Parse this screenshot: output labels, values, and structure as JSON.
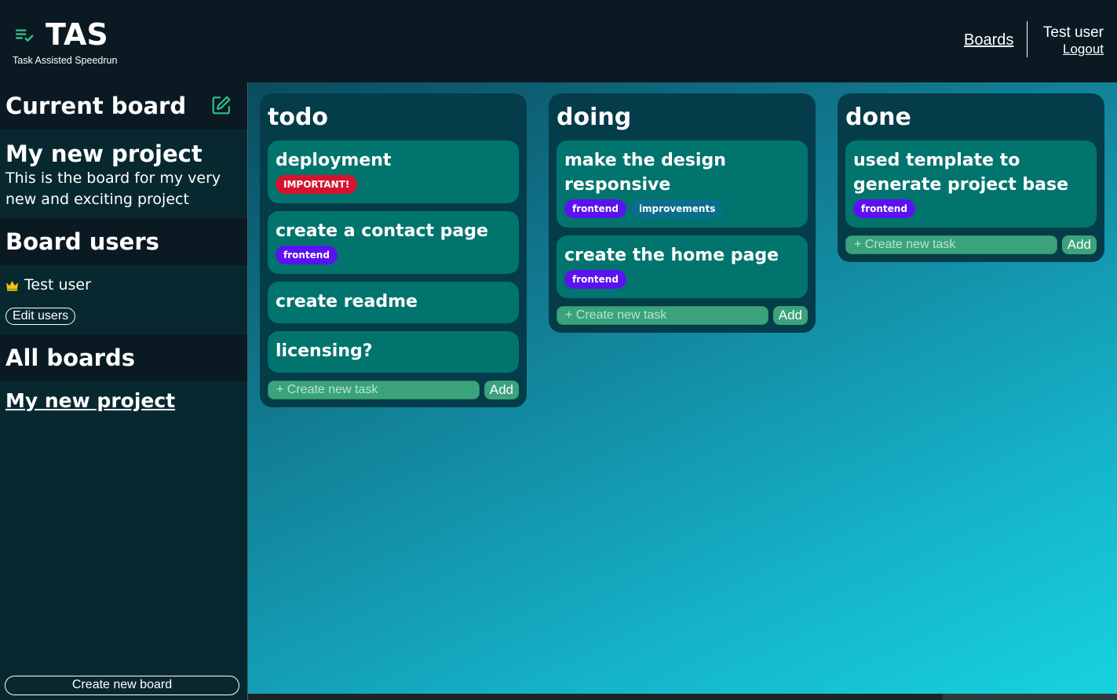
{
  "header": {
    "title": "TAS",
    "subtitle": "Task Assisted Speedrun",
    "nav_boards": "Boards",
    "user_name": "Test user",
    "logout": "Logout"
  },
  "sidebar": {
    "current_board_heading": "Current board",
    "board_name": "My new project",
    "board_description": "This is the board for my very new and exciting project",
    "board_users_heading": "Board users",
    "users": [
      {
        "name": "Test user",
        "icon": "crown-icon"
      }
    ],
    "edit_users": "Edit users",
    "all_boards_heading": "All boards",
    "boards": [
      "My new project"
    ],
    "create_board": "Create new board"
  },
  "columns": [
    {
      "title": "todo",
      "cards": [
        {
          "title": "deployment",
          "tags": [
            {
              "label": "IMPORTANT!",
              "color": "#d6132f"
            }
          ]
        },
        {
          "title": "create a contact page",
          "tags": [
            {
              "label": "frontend",
              "color": "#5b12f0"
            }
          ]
        },
        {
          "title": "create readme",
          "tags": []
        },
        {
          "title": "licensing?",
          "tags": []
        }
      ]
    },
    {
      "title": "doing",
      "cards": [
        {
          "title": "make the design responsive",
          "tags": [
            {
              "label": "frontend",
              "color": "#5b12f0"
            },
            {
              "label": "improvements",
              "color": "#0b6e8c"
            }
          ]
        },
        {
          "title": "create the home page",
          "tags": [
            {
              "label": "frontend",
              "color": "#5b12f0"
            }
          ]
        }
      ]
    },
    {
      "title": "done",
      "cards": [
        {
          "title": "used template to generate project base",
          "tags": [
            {
              "label": "frontend",
              "color": "#5b12f0"
            }
          ]
        }
      ]
    }
  ],
  "new_task_placeholder": "+ Create new task",
  "add_label": "Add",
  "colors": {
    "accent": "#2fc08a",
    "card": "#02746e",
    "column": "#043c4a",
    "input": "#3aa37b"
  }
}
